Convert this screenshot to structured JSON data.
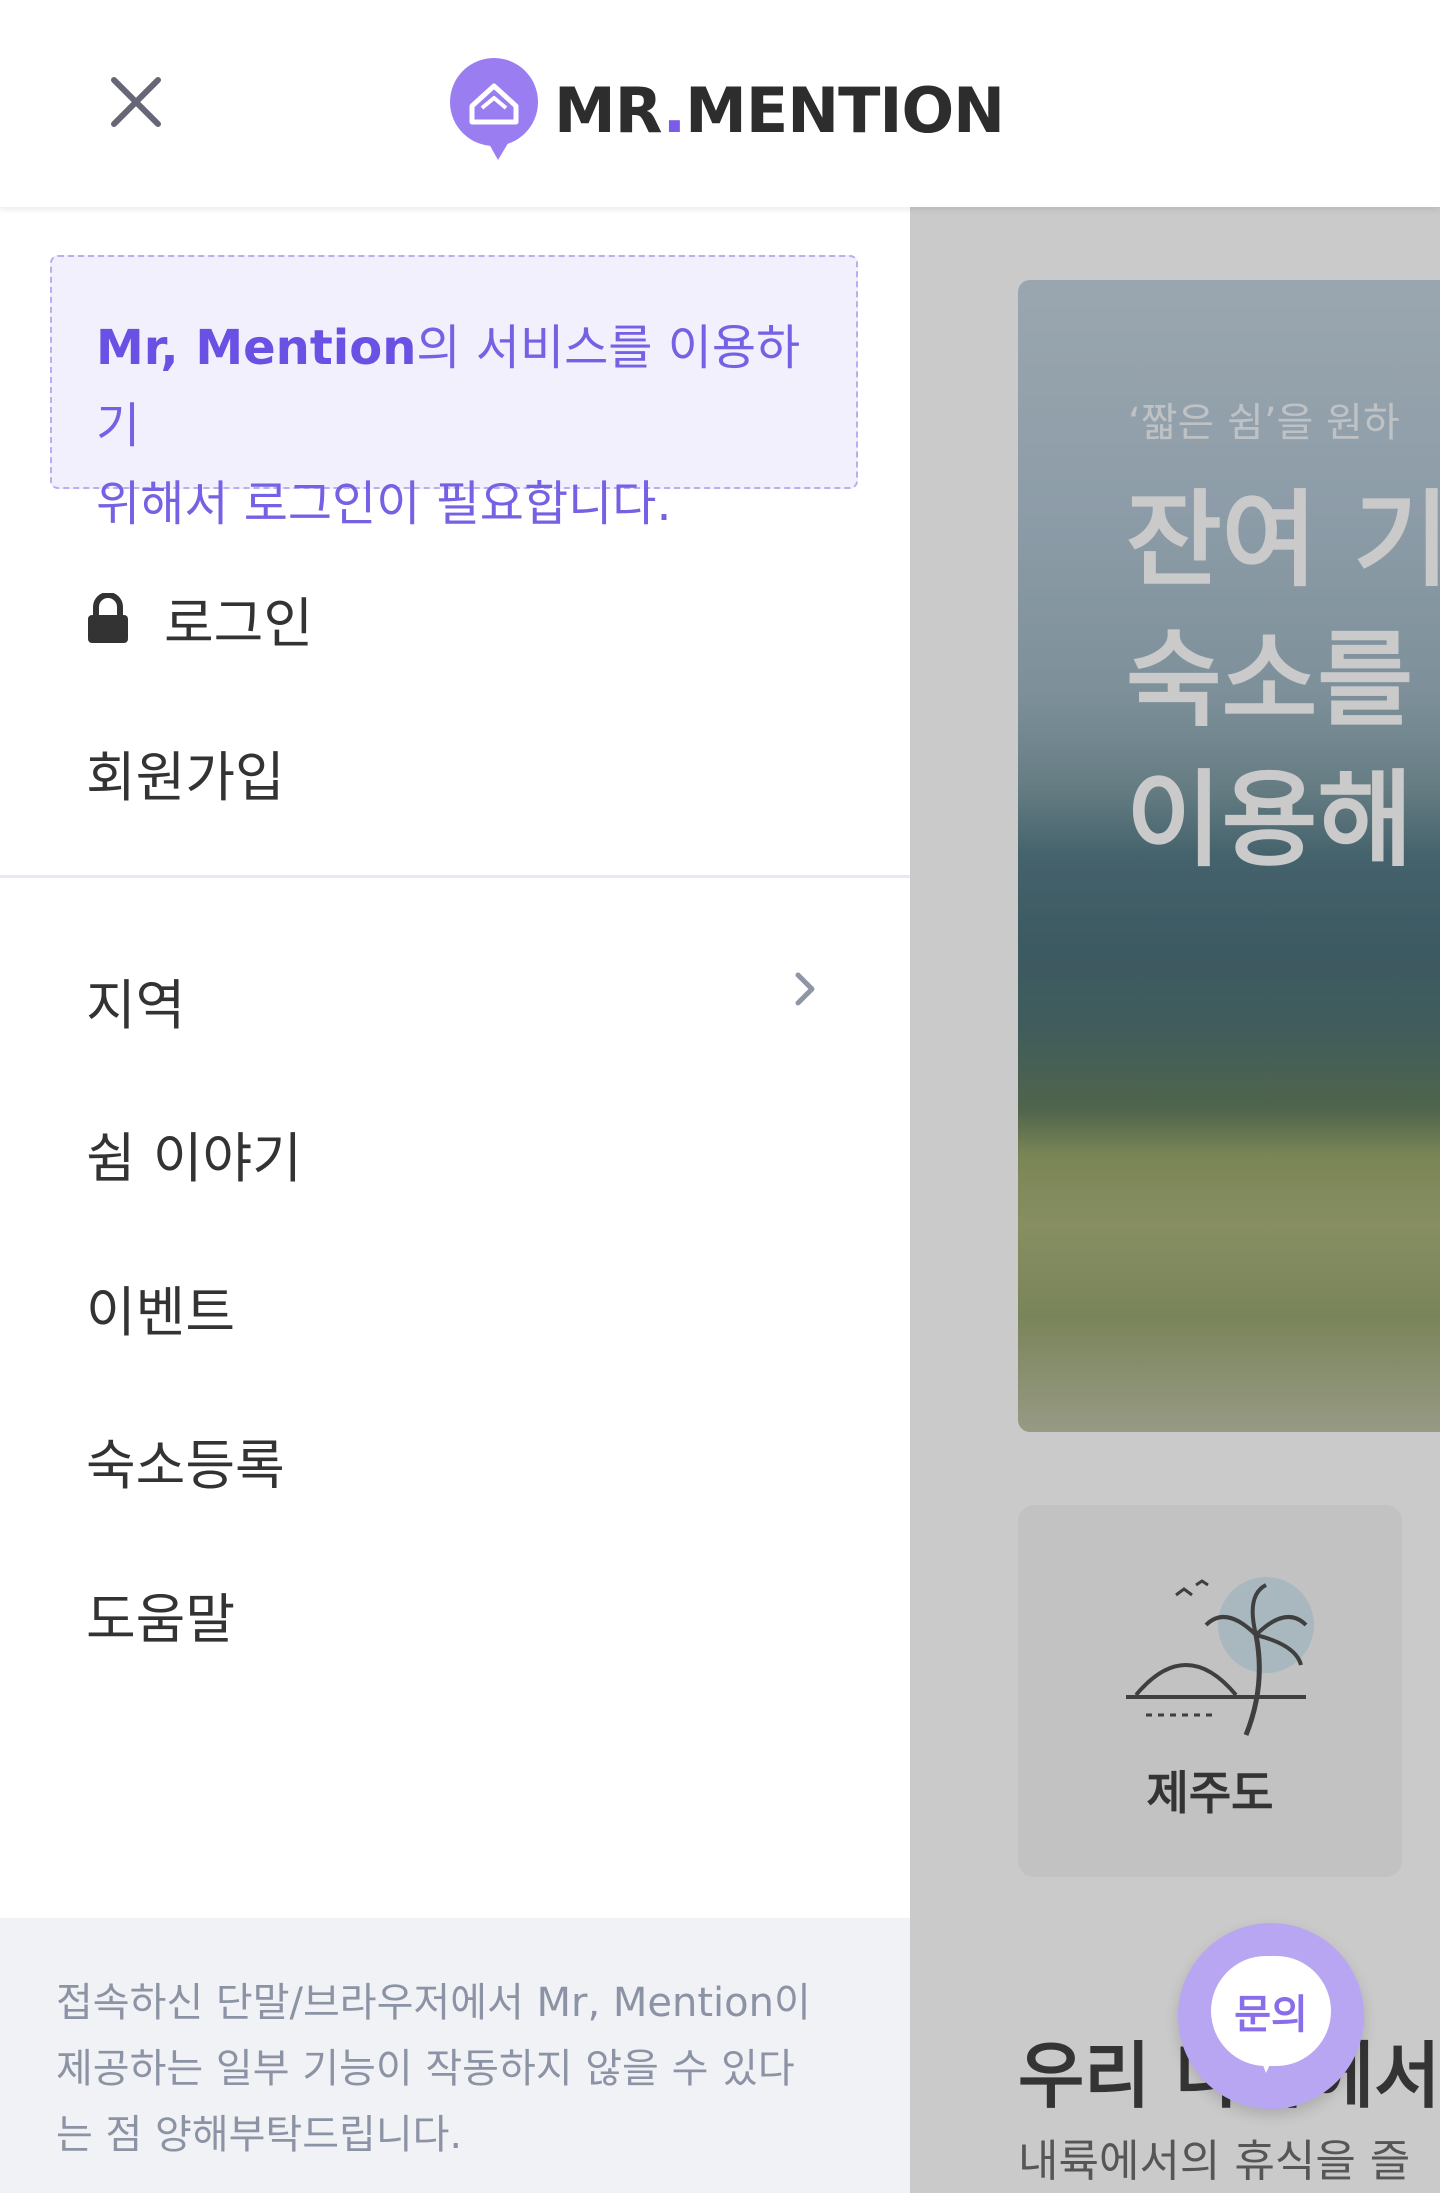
{
  "header": {
    "logo_text_prefix": "MR",
    "logo_text_dot": ".",
    "logo_text_suffix": "MENTION"
  },
  "drawer": {
    "notice": {
      "brand": "Mr, Mention",
      "line1_rest": "의 서비스를 이용하기",
      "line2": "위해서 로그인이 필요합니다."
    },
    "auth_items": [
      {
        "label": "로그인",
        "icon": "lock-icon"
      },
      {
        "label": "회원가입"
      }
    ],
    "menu_items": [
      {
        "label": "지역",
        "icon": "chevron-right-icon"
      },
      {
        "label": "쉼 이야기"
      },
      {
        "label": "이벤트"
      },
      {
        "label": "숙소등록"
      },
      {
        "label": "도움말"
      }
    ],
    "footer_note": "접속하신 단말/브라우저에서 Mr, Mention이 제공하는 일부 기능이 작동하지 않을 수 있다는 점 양해부탁드립니다.",
    "footer_lines": [
      "접속하신 단말/브라우저에서 Mr, Mention이",
      "제공하는 일부 기능이 작동하지 않을 수 있다",
      "는 점 양해부탁드립니다."
    ]
  },
  "background_page": {
    "banner_subtitle": "‘짧은 쉼’을 원하",
    "banner_title_lines": [
      "잔여 기",
      "숙소를",
      "이용해"
    ],
    "category_label": "제주도",
    "section_title": "우리 나라에서",
    "section_subtitle": "내륙에서의 휴식을 즐"
  },
  "fab": {
    "label": "문의"
  },
  "colors": {
    "brand_purple": "#7a5ce8",
    "notice_bg": "#f1f0fc",
    "footer_bg": "#f1f2f6"
  }
}
